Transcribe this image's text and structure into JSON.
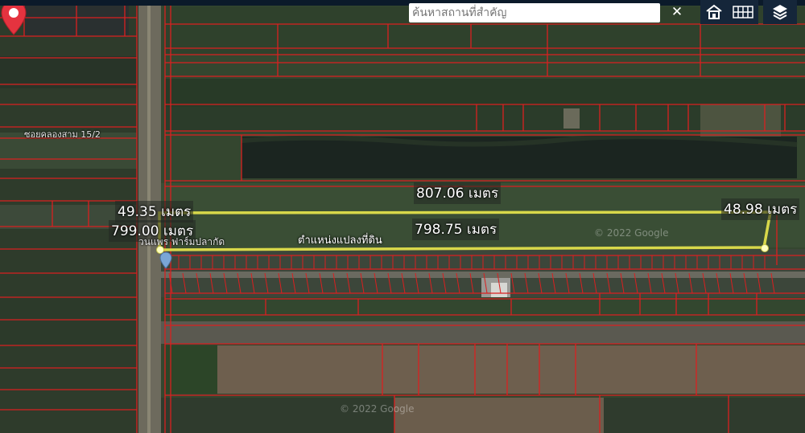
{
  "search": {
    "placeholder": "ค้นหาสถานที่สำคัญ"
  },
  "controls": {
    "clear_icon": "close-icon",
    "home_icon": "home-icon",
    "grid_icon": "grid-icon",
    "layers_icon": "layers-icon"
  },
  "plot": {
    "marker_label": "ตำแหน่งแปลงที่ดิน",
    "measure_top": "807.06 เมตร",
    "measure_bottom": "798.75 เมตร",
    "measure_left_short": "49.35 เมตร",
    "measure_left_long": "799.00 เมตร",
    "measure_right": "48.98 เมตร",
    "outline_color": "#d8d84a"
  },
  "map_labels": {
    "road": "ซอยคลองสาม 15/2",
    "business": "วนแพร ฟาร์มปลากัด",
    "watermark_1": "© 2022 Google",
    "watermark_2": "© 2022 Google"
  },
  "colors": {
    "parcel_line": "#d92020",
    "canal": "#1b2520",
    "field": "#34462f"
  }
}
